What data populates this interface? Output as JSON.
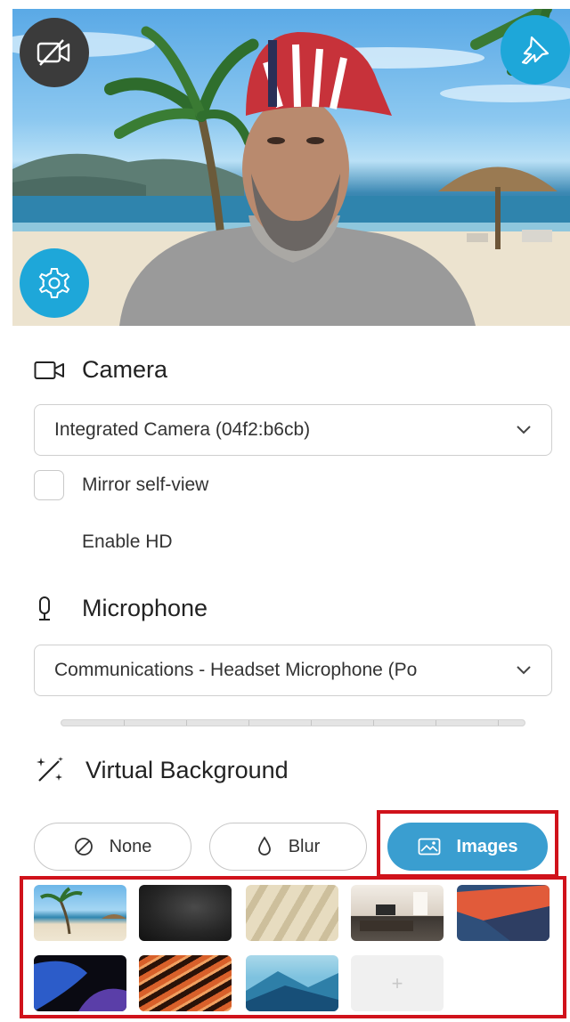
{
  "preview": {
    "buttons": [
      "camera-off-icon",
      "pin-icon",
      "gear-icon"
    ]
  },
  "camera": {
    "heading": "Camera",
    "selected_device": "Integrated Camera (04f2:b6cb)",
    "mirror_label": "Mirror self-view",
    "mirror_checked": false,
    "hd_label": "Enable HD"
  },
  "microphone": {
    "heading": "Microphone",
    "selected_device": "Communications - Headset Microphone (Po"
  },
  "virtual_background": {
    "heading": "Virtual Background",
    "options": {
      "none": "None",
      "blur": "Blur",
      "images": "Images"
    },
    "selected": "Images",
    "add_label": "+",
    "thumbnails": [
      "beach",
      "dark-abstract",
      "blurred-window",
      "living-room",
      "orange-blue-geometric",
      "blue-purple-abstract",
      "orange-agate",
      "blue-mountains"
    ]
  },
  "colors": {
    "accent": "#1ea7d9",
    "selected_button": "#3a9ed0",
    "highlight": "#d0121b",
    "dark_button": "#3b3b3b"
  }
}
